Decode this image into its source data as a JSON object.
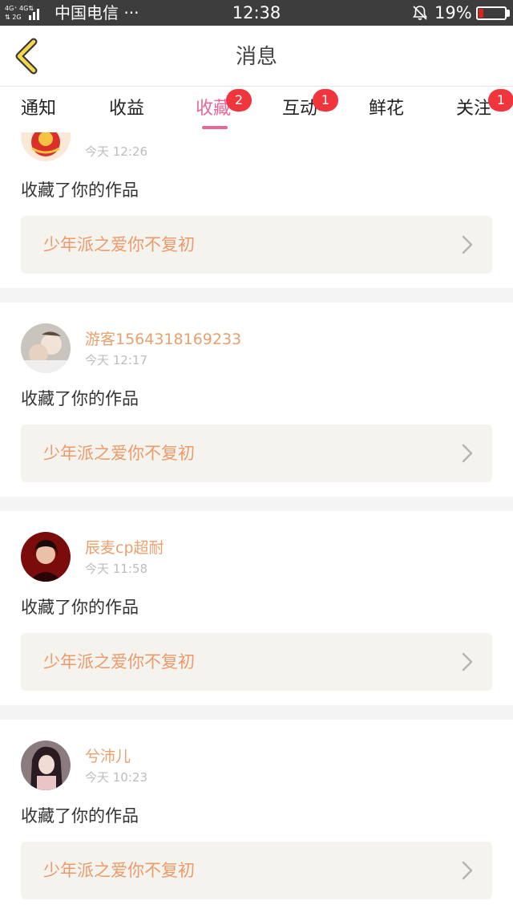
{
  "status_bar": {
    "network": "4G⁺ 4G\n⇅ 2G",
    "carrier": "中国电信 ···",
    "time": "12:38",
    "battery_percent": "19%",
    "battery_level": 0.19,
    "battery_color": "#e0201b"
  },
  "header": {
    "title": "消息",
    "back_icon": "chevron-left-icon"
  },
  "tabs": [
    {
      "label": "通知",
      "badge": ""
    },
    {
      "label": "收益",
      "badge": ""
    },
    {
      "label": "收藏",
      "badge": "2",
      "active": true
    },
    {
      "label": "互动",
      "badge": "1"
    },
    {
      "label": "鲜花",
      "badge": ""
    },
    {
      "label": "关注",
      "badge": "1"
    }
  ],
  "colors": {
    "accent": "#e8679a",
    "badge": "#f0353d",
    "name": "#e9a06c",
    "link_text": "#ec9a6a"
  },
  "items": [
    {
      "user_name": "",
      "time": "今天 12:26",
      "message": "收藏了你的作品",
      "work_title": "少年派之爱你不复初"
    },
    {
      "user_name": "游客1564318169233",
      "time": "今天 12:17",
      "message": "收藏了你的作品",
      "work_title": "少年派之爱你不复初"
    },
    {
      "user_name": "辰麦cp超耐",
      "time": "今天 11:58",
      "message": "收藏了你的作品",
      "work_title": "少年派之爱你不复初"
    },
    {
      "user_name": "兮沛儿",
      "time": "今天 10:23",
      "message": "收藏了你的作品",
      "work_title": "少年派之爱你不复初"
    }
  ]
}
